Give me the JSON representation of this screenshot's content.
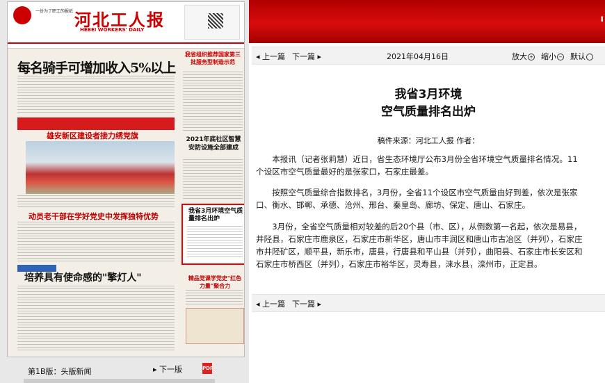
{
  "banner": {
    "right_glyph": "ı"
  },
  "newspaper": {
    "masthead_title": "河北工人报",
    "masthead_en": "HEBEI WORKERS' DAILY",
    "masthead_slogan": "一份为了职工的报纸",
    "headline_main": "每名骑手可增加收入5%以上",
    "headline_right_top": "我省组织推荐国家第三批服务型制造示范",
    "headline_xiongan": "雄安新区建设者接力绣党旗",
    "headline_right_mid": "2021年底社区智慧安防设施全部建成",
    "headline_mid": "动员老干部在学好党史中发挥独特优势",
    "headline_highlight": "我省3月环境空气质量排名出炉",
    "headline_bottom": "培养具有使命感的\"擎灯人\"",
    "headline_right_bottom": "精品党课学党史\"红色力量\"聚合力"
  },
  "bottom_bar": {
    "page_label": "第1B版：头版新闻",
    "next_edition": "下一版",
    "pdf_icon_text": "PDF"
  },
  "nav": {
    "prev": "上一篇",
    "next": "下一篇",
    "date": "2021年04月16日",
    "zoom_in": "放大",
    "zoom_out": "缩小",
    "zoom_default": "默认"
  },
  "article": {
    "title_line1": "我省3月环境",
    "title_line2": "空气质量排名出炉",
    "source": "稿件来源：河北工人报  作者：",
    "paragraphs": [
      "本报讯（记者张莉慧）近日，省生态环境厅公布3月份全省环境空气质量排名情况。11个设区市空气质量最好的是张家口，石家庄最差。",
      "按照空气质量综合指数排名，3月份，全省11个设区市空气质量由好到差，依次是张家口、衡水、邯郸、承德、沧州、邢台、秦皇岛、廊坊、保定、唐山、石家庄。",
      "3月份，全省空气质量相对较差的后20个县（市、区），从倒数第一名起，依次是易县，井陉县，石家庄市鹿泉区，石家庄市新华区，唐山市丰润区和唐山市古冶区（并列），石家庄市井陉矿区，顺平县，新乐市，唐县，行唐县和平山县（并列），曲阳县、石家庄市长安区和石家庄市桥西区（并列），石家庄市裕华区，灵寿县，涞水县，滦州市，正定县。"
    ]
  }
}
